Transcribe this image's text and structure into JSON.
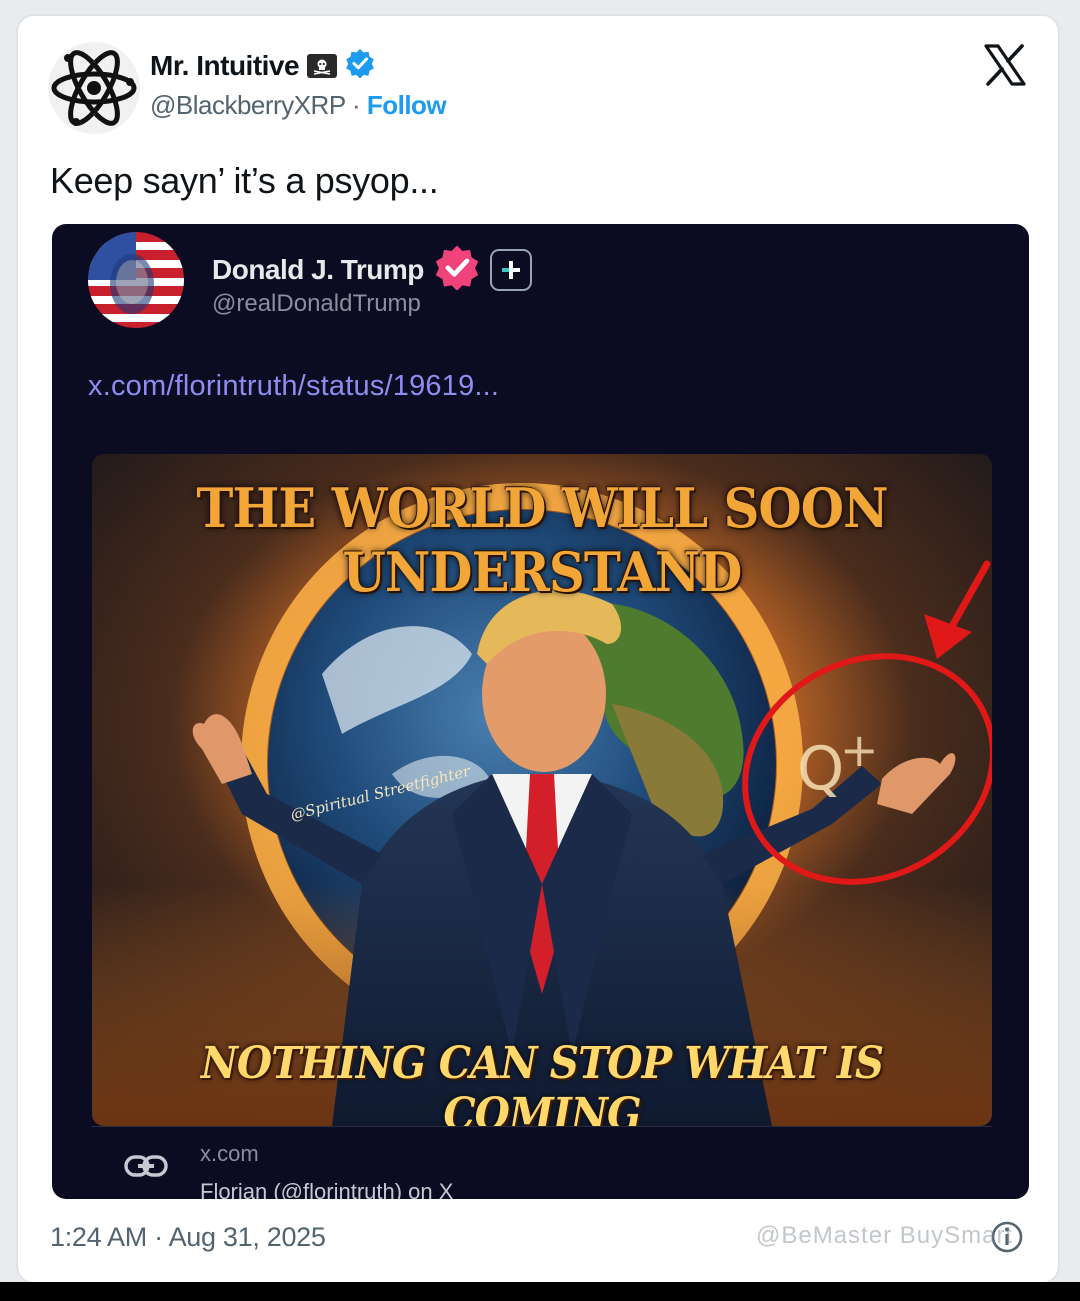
{
  "author": {
    "name": "Mr. Intuitive",
    "handle": "@BlackberryXRP",
    "separator": "·",
    "follow_label": "Follow"
  },
  "tweet": {
    "text": "Keep sayn’ it’s a psyop...",
    "timestamp": "1:24 AM · Aug 31, 2025"
  },
  "embedded_post": {
    "name": "Donald J. Trump",
    "handle": "@realDonaldTrump",
    "link_text": "x.com/florintruth/status/19619...",
    "image_headline_top": "THE WORLD WILL SOON UNDERSTAND",
    "image_headline_bottom": "NOTHING CAN STOP WHAT IS COMING",
    "image_signature": "@Spiritual Streetfighter",
    "card_domain": "x.com",
    "card_title": "Florian (@florintruth) on X"
  },
  "overlay_watermark": "@BeMaster BuySmart",
  "colors": {
    "verified_blue": "#1d9bf0",
    "follow_blue": "#1d9bf0",
    "embed_bg": "#0b0b22",
    "embed_link": "#8f8cf0",
    "verified_pink": "#f0437b",
    "annotation_red": "#e01818"
  },
  "icons": [
    "atom-icon",
    "pirate-flag-icon",
    "verified-icon",
    "x-logo-icon",
    "link-icon",
    "info-icon",
    "plus-icon"
  ]
}
